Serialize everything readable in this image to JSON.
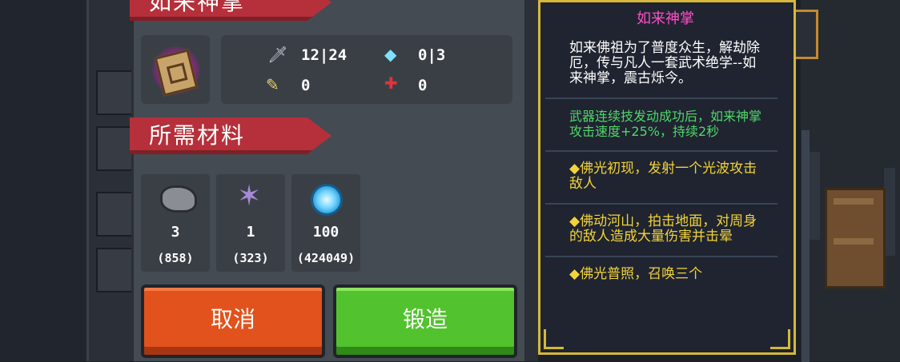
{
  "item": {
    "name": "如来神掌",
    "icon": "scripture-book-icon"
  },
  "stats": {
    "damage": "12|24",
    "energy": "0|3",
    "crit": "0",
    "precision": "0"
  },
  "materials": {
    "header": "所需材料",
    "items": [
      {
        "icon": "ore-stone-icon",
        "required": "3",
        "owned": "(858)"
      },
      {
        "icon": "crystal-shard-icon",
        "required": "1",
        "owned": "(323)"
      },
      {
        "icon": "blue-gem-icon",
        "required": "100",
        "owned": "(424049)"
      }
    ]
  },
  "buttons": {
    "cancel": "取消",
    "forge": "锻造"
  },
  "description": {
    "title": "如来神掌",
    "lore": "如来佛祖为了普度众生，解劫除厄，传与凡人一套武术绝学--如来神掌，震古烁今。",
    "effect": "武器连续技发动成功后，如来神掌攻击速度+25%，持续2秒",
    "skill1": "◆佛光初现，发射一个光波攻击敌人",
    "skill2": "◆佛动河山，拍击地面，对周身的敌人造成大量伤害并击晕",
    "skill3": "◆佛光普照，召唤三个"
  },
  "colors": {
    "ribbon": "#b5303a",
    "cancel": "#e2521c",
    "forge": "#52c22e",
    "title_pink": "#ff4fc6",
    "effect_green": "#4fd66a",
    "skill_yellow": "#f2d33a"
  }
}
